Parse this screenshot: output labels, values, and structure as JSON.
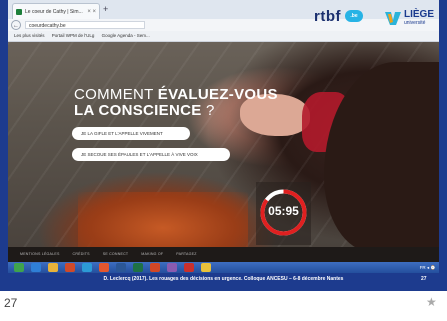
{
  "browser": {
    "tab_title": "Le coeur de Cathy | Sim...",
    "tab_close": "× ×",
    "new_tab": "+",
    "back": "←",
    "url": "coeurdecathy.be",
    "bookmarks": [
      "Les plus visités",
      "Portail WPM de l'ULg",
      "Google Agenda - Sem..."
    ]
  },
  "logos": {
    "rtbf": "rtbf",
    "rtbf_badge": ".be",
    "liege": "LIÈGE",
    "liege_sub": "université"
  },
  "question": {
    "line1_light": "COMMENT ",
    "line1_bold": "ÉVALUEZ-VOUS",
    "line2_bold": "LA CONSCIENCE",
    "line2_tail": " ?"
  },
  "choices": [
    "JE LA GIFLE ET L'APPELLE VIVEMENT",
    "JE SECOUE SES ÉPAULES ET L'APPELLE À VIVE VOIX"
  ],
  "timer": {
    "label": "05:95",
    "progress": 0.85,
    "ring_color": "#e02020"
  },
  "site_footer": [
    "MENTIONS LÉGALES",
    "CRÉDITS",
    "SE CONNECT",
    "MAKING OF",
    "PARTAGEZ"
  ],
  "taskbar": {
    "apps": [
      "start",
      "ie",
      "explorer",
      "media",
      "chrome",
      "firefox",
      "word",
      "excel",
      "powerpoint",
      "photo",
      "acrobat",
      "folder"
    ],
    "tray": "FR ◂ ⌚"
  },
  "citation": "D. Leclercq (2017). Les rouages des décisions en urgence. Colloque ANCESU – 6-8 décembre Nantes",
  "slide_number": "27",
  "page_number": "27",
  "colors": {
    "slide_bg": "#1d3b8e",
    "timer_ring": "#e02020",
    "shirt_red": "#b3192b"
  }
}
